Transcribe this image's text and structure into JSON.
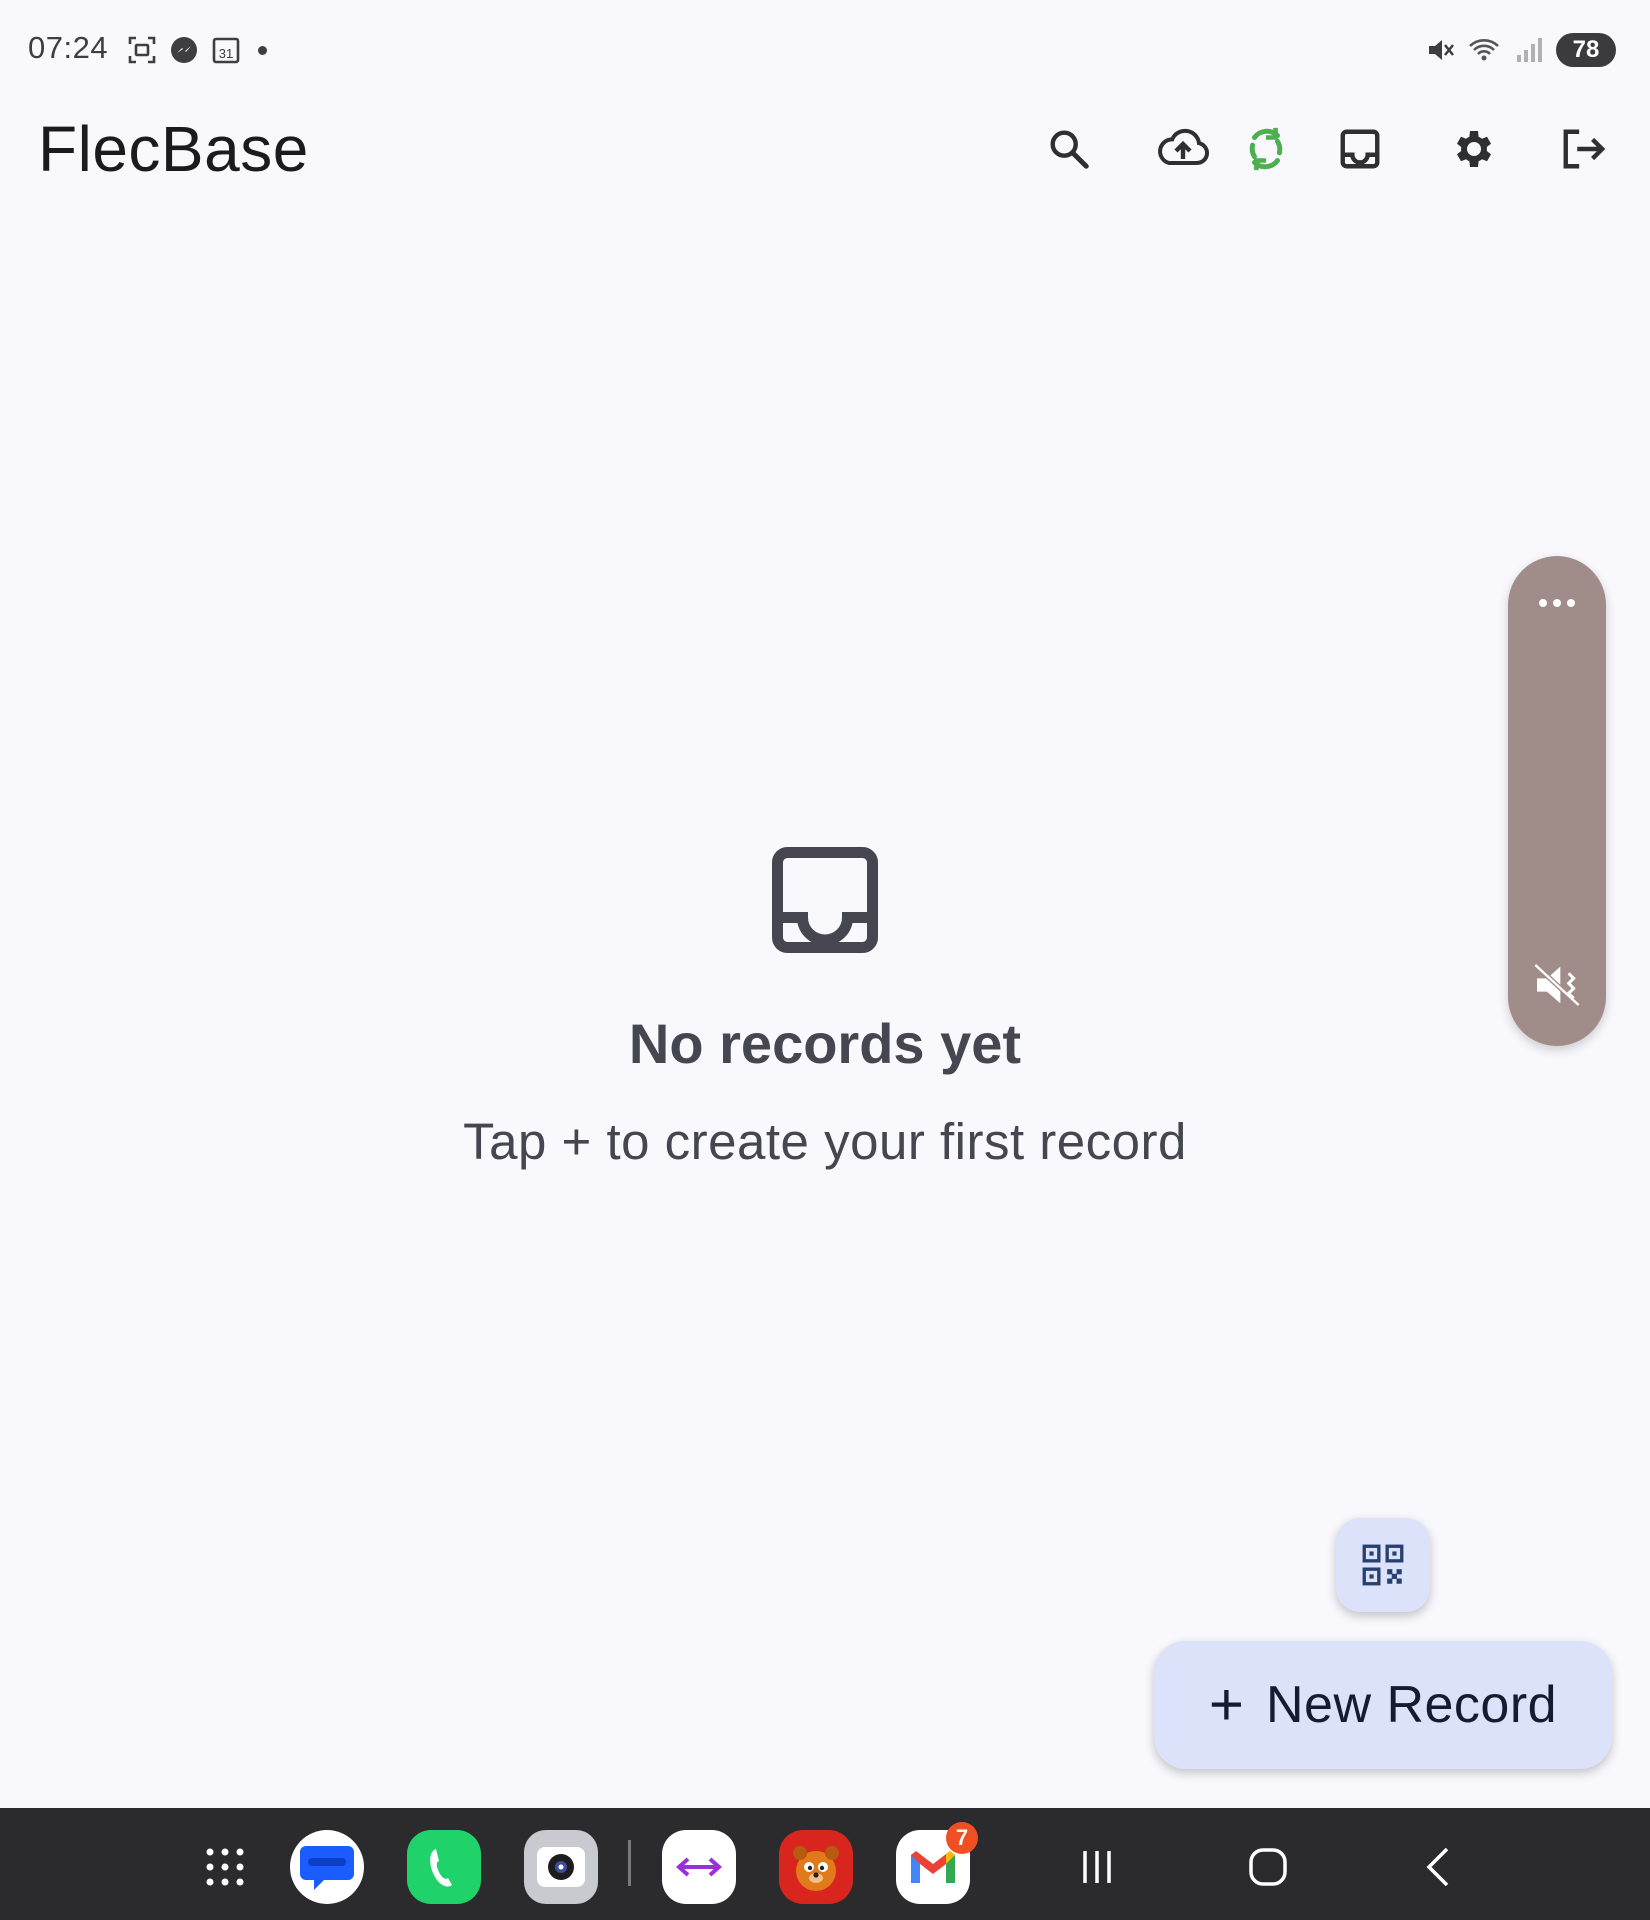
{
  "status_bar": {
    "time": "07:24",
    "battery": "78",
    "left_icons": [
      "screen-capture-icon",
      "messenger-icon",
      "calendar-icon"
    ],
    "right_icons": [
      "mute-icon",
      "wifi-icon",
      "signal-icon"
    ]
  },
  "app_bar": {
    "title": "FlecBase",
    "actions": [
      "search-icon",
      "cloud-upload-icon",
      "sync-icon",
      "inbox-icon",
      "settings-icon",
      "logout-icon"
    ],
    "sync_color": "#4caf50"
  },
  "empty_state": {
    "icon": "inbox-icon",
    "title": "No records yet",
    "subtitle": "Tap + to create your first record"
  },
  "side_panel": {
    "top_icon": "more-icon",
    "bottom_icon": "mute-icon",
    "color": "#a08c88"
  },
  "fab": {
    "qr_icon": "qr-code-icon",
    "plus": "+",
    "new_record_label": "New Record",
    "container_color": "#dce2f9"
  },
  "taskbar": {
    "apps": [
      {
        "name": "apps-grid-icon"
      },
      {
        "name": "messages-app-icon"
      },
      {
        "name": "phone-app-icon"
      },
      {
        "name": "camera-app-icon"
      },
      {
        "name": "link-app-icon"
      },
      {
        "name": "game-app-icon"
      },
      {
        "name": "gmail-app-icon",
        "badge": "7"
      }
    ],
    "nav": [
      "recent-apps-icon",
      "home-icon",
      "back-icon"
    ]
  }
}
